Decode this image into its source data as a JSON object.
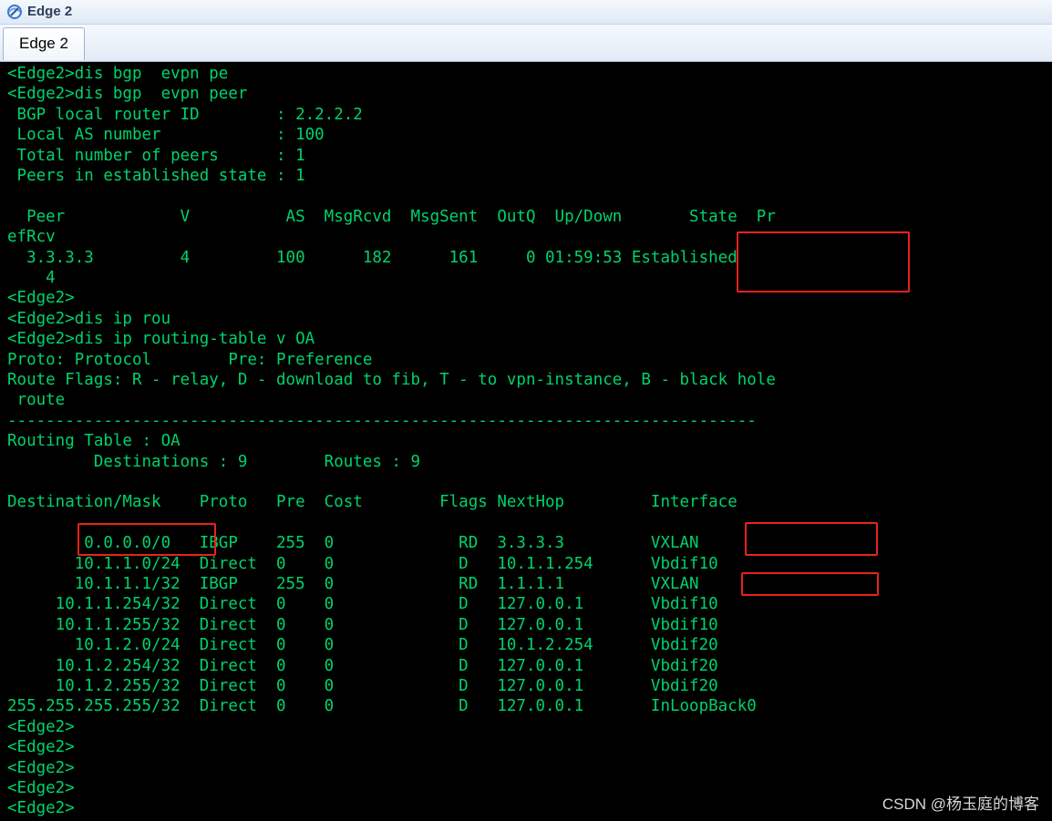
{
  "window": {
    "title": "Edge 2",
    "tab_label": "Edge 2"
  },
  "terminal": {
    "lines": [
      "<Edge2>dis bgp  evpn pe",
      "<Edge2>dis bgp  evpn peer",
      " BGP local router ID        : 2.2.2.2",
      " Local AS number            : 100",
      " Total number of peers      : 1",
      " Peers in established state : 1",
      "",
      "  Peer            V          AS  MsgRcvd  MsgSent  OutQ  Up/Down       State  Pr",
      "efRcv",
      "  3.3.3.3         4         100      182      161     0 01:59:53 Established",
      "    4",
      "<Edge2>",
      "<Edge2>dis ip rou",
      "<Edge2>dis ip routing-table v OA",
      "Proto: Protocol        Pre: Preference",
      "Route Flags: R - relay, D - download to fib, T - to vpn-instance, B - black hole",
      " route",
      "------------------------------------------------------------------------------",
      "Routing Table : OA",
      "         Destinations : 9        Routes : 9",
      "",
      "Destination/Mask    Proto   Pre  Cost        Flags NextHop         Interface",
      "",
      "        0.0.0.0/0   IBGP    255  0             RD  3.3.3.3         VXLAN",
      "       10.1.1.0/24  Direct  0    0             D   10.1.1.254      Vbdif10",
      "       10.1.1.1/32  IBGP    255  0             RD  1.1.1.1         VXLAN",
      "     10.1.1.254/32  Direct  0    0             D   127.0.0.1       Vbdif10",
      "     10.1.1.255/32  Direct  0    0             D   127.0.0.1       Vbdif10",
      "       10.1.2.0/24  Direct  0    0             D   10.1.2.254      Vbdif20",
      "     10.1.2.254/32  Direct  0    0             D   127.0.0.1       Vbdif20",
      "     10.1.2.255/32  Direct  0    0             D   127.0.0.1       Vbdif20",
      "255.255.255.255/32  Direct  0    0             D   127.0.0.1       InLoopBack0",
      "<Edge2>",
      "<Edge2>",
      "<Edge2>",
      "<Edge2>",
      "<Edge2>"
    ]
  },
  "watermark": "CSDN @杨玉庭的博客",
  "colors": {
    "terminal_text": "#00d26a",
    "terminal_bg": "#000000",
    "highlight_box": "#e8231a"
  }
}
